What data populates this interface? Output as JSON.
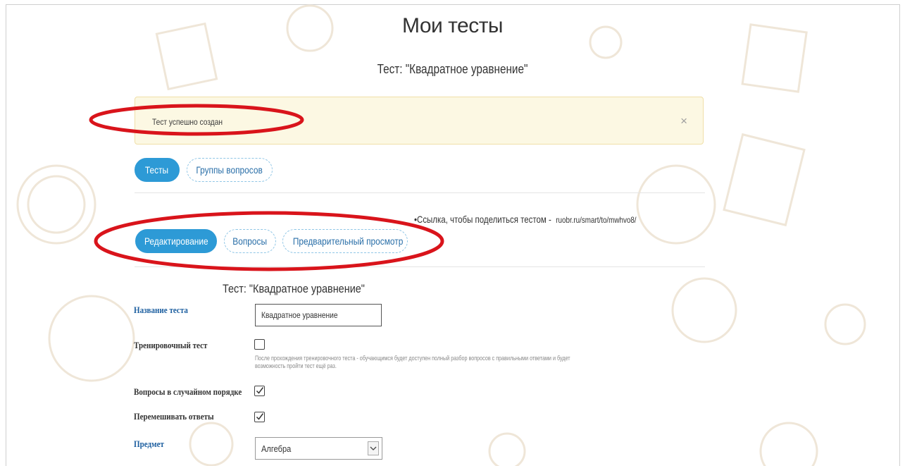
{
  "page": {
    "title": "Мои тесты",
    "subtitle": "Тест: \"Квадратное уравнение\""
  },
  "alert": {
    "text": "Тест успешно создан",
    "close_label": "×"
  },
  "top_tabs": [
    {
      "label": "Тесты",
      "active": true
    },
    {
      "label": "Группы вопросов",
      "active": false
    }
  ],
  "share": {
    "text": "Ссылка, чтобы поделиться тестом - ",
    "url": "ruobr.ru/smart/to/mwhvo8/"
  },
  "sub_tabs": [
    {
      "label": "Редактирование",
      "active": true
    },
    {
      "label": "Вопросы",
      "active": false
    },
    {
      "label": "Предварительный просмотр",
      "active": false
    }
  ],
  "form": {
    "heading": "Тест: \"Квадратное уравнение\"",
    "name_label": "Название теста",
    "name_value": "Квадратное уравнение",
    "training_label": "Тренировочный тест",
    "training_checked": false,
    "training_help": "После прохождения тренировочного теста - обучающимся будет доступен полный разбор вопросов с правильными ответами и будет возможность пройти тест ещё раз.",
    "random_order_label": "Вопросы в случайном порядке",
    "random_order_checked": true,
    "shuffle_label": "Перемешивать ответы",
    "shuffle_checked": true,
    "subject_label": "Предмет",
    "subject_value": "Алгебра"
  },
  "colors": {
    "accent": "#2d9ad6",
    "alert_bg": "#fcf8e3",
    "annotation_red": "#d9141b",
    "label_blue": "#1d5fa0"
  }
}
